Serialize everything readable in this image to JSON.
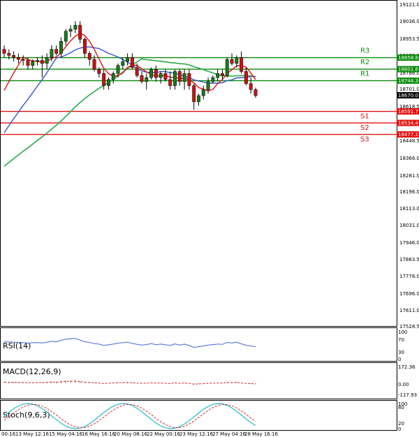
{
  "main": {
    "y_labels": [
      "19121.0",
      "19036.0",
      "18953.5",
      "18870.5",
      "18786.0",
      "18701.0",
      "18618.5",
      "18533.5",
      "18448.5",
      "18366.0",
      "18281.0",
      "18196.0",
      "18113.0",
      "18031.0",
      "17946.0",
      "17863.5",
      "17778.0",
      "17696.0",
      "17611.0",
      "17528.5"
    ],
    "levels": [
      {
        "name": "R3",
        "value": 18858.8,
        "label": "18858.8",
        "color": "#0a8a0a"
      },
      {
        "name": "R2",
        "value": 18801.6,
        "label": "18801.6",
        "color": "#0a8a0a"
      },
      {
        "name": "R1",
        "value": 18744.3,
        "label": "18744.3",
        "color": "#0a8a0a"
      },
      {
        "name": "S1",
        "value": 18591.7,
        "label": "18591.7",
        "color": "#e01010"
      },
      {
        "name": "S2",
        "value": 18534.4,
        "label": "18534.4",
        "color": "#e01010"
      },
      {
        "name": "S3",
        "value": 18477.2,
        "label": "18477.2",
        "color": "#e01010"
      }
    ],
    "current_price": {
      "value": 18670.0,
      "label": "18670.0"
    }
  },
  "x_labels": [
    "00:16",
    "13 May 12:16",
    "15 May 04:16",
    "16 May 16:16",
    "20 May 08:16",
    "22 May 00:16",
    "23 May 12:16",
    "27 May 04:16",
    "28 May 16:16"
  ],
  "rsi": {
    "title": "RSI(14)",
    "labels": [
      "100",
      "70",
      "30",
      "0"
    ]
  },
  "macd": {
    "title": "MACD(12,26,9)",
    "labels": [
      "172.36",
      "0.00",
      "-117.93"
    ]
  },
  "stoch": {
    "title": "Stoch(9,6,3)",
    "labels": [
      "100",
      "80",
      "20",
      "0"
    ]
  },
  "colors": {
    "bull": "#1a7a1a",
    "bear": "#cc1111",
    "ma_fast": "#e01010",
    "ma_mid": "#3355cc",
    "ma_slow": "#2aa84a",
    "rsi": "#4466dd",
    "macd_signal": "#dd2222",
    "stoch_k": "#22bbcc",
    "stoch_d": "#dd2222"
  },
  "chart_data": {
    "type": "candlestick",
    "ylim": [
      17528.5,
      19121.0
    ],
    "candles": [
      [
        18900,
        18920,
        18860,
        18880
      ],
      [
        18880,
        18900,
        18850,
        18870
      ],
      [
        18870,
        18890,
        18840,
        18860
      ],
      [
        18860,
        18880,
        18830,
        18850
      ],
      [
        18850,
        18870,
        18820,
        18845
      ],
      [
        18845,
        18860,
        18800,
        18820
      ],
      [
        18820,
        18850,
        18800,
        18840
      ],
      [
        18840,
        18860,
        18820,
        18845
      ],
      [
        18845,
        18870,
        18760,
        18830
      ],
      [
        18830,
        18880,
        18800,
        18860
      ],
      [
        18860,
        18920,
        18840,
        18900
      ],
      [
        18900,
        18920,
        18870,
        18880
      ],
      [
        18880,
        18960,
        18860,
        18940
      ],
      [
        18940,
        19000,
        18920,
        18990
      ],
      [
        18990,
        19020,
        18960,
        19000
      ],
      [
        19000,
        19040,
        18980,
        19020
      ],
      [
        19020,
        19040,
        18930,
        18950
      ],
      [
        18950,
        18960,
        18860,
        18880
      ],
      [
        18880,
        18890,
        18820,
        18850
      ],
      [
        18850,
        18870,
        18790,
        18800
      ],
      [
        18800,
        18810,
        18760,
        18780
      ],
      [
        18780,
        18800,
        18700,
        18720
      ],
      [
        18720,
        18760,
        18700,
        18750
      ],
      [
        18750,
        18790,
        18730,
        18780
      ],
      [
        18780,
        18830,
        18760,
        18820
      ],
      [
        18820,
        18860,
        18800,
        18840
      ],
      [
        18840,
        18880,
        18820,
        18860
      ],
      [
        18860,
        18880,
        18800,
        18810
      ],
      [
        18810,
        18830,
        18760,
        18770
      ],
      [
        18770,
        18790,
        18730,
        18740
      ],
      [
        18740,
        18780,
        18700,
        18760
      ],
      [
        18760,
        18810,
        18750,
        18800
      ],
      [
        18800,
        18820,
        18740,
        18760
      ],
      [
        18760,
        18790,
        18730,
        18780
      ],
      [
        18780,
        18800,
        18740,
        18750
      ],
      [
        18750,
        18790,
        18700,
        18720
      ],
      [
        18720,
        18800,
        18700,
        18790
      ],
      [
        18790,
        18800,
        18720,
        18740
      ],
      [
        18740,
        18800,
        18700,
        18780
      ],
      [
        18780,
        18800,
        18700,
        18720
      ],
      [
        18720,
        18730,
        18600,
        18640
      ],
      [
        18640,
        18680,
        18620,
        18670
      ],
      [
        18670,
        18720,
        18650,
        18700
      ],
      [
        18700,
        18760,
        18680,
        18740
      ],
      [
        18740,
        18770,
        18730,
        18760
      ],
      [
        18760,
        18800,
        18740,
        18780
      ],
      [
        18780,
        18800,
        18750,
        18770
      ],
      [
        18770,
        18860,
        18760,
        18850
      ],
      [
        18850,
        18880,
        18820,
        18830
      ],
      [
        18830,
        18870,
        18810,
        18860
      ],
      [
        18860,
        18890,
        18780,
        18790
      ],
      [
        18790,
        18810,
        18720,
        18730
      ],
      [
        18730,
        18760,
        18680,
        18700
      ],
      [
        18700,
        18710,
        18660,
        18670
      ]
    ]
  }
}
